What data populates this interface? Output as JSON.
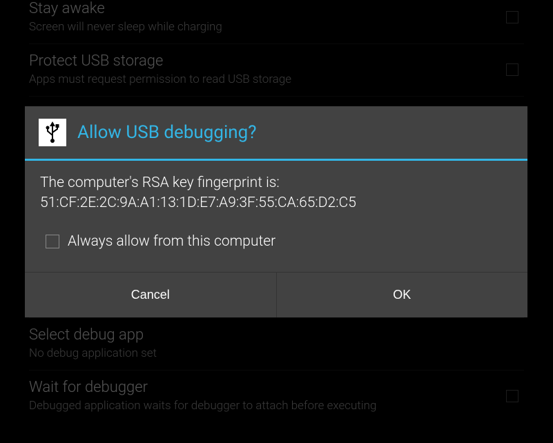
{
  "settings": {
    "items": [
      {
        "title": "Stay awake",
        "subtitle": "Screen will never sleep while charging",
        "hasCheckbox": true
      },
      {
        "title": "Protect USB storage",
        "subtitle": "Apps must request permission to read USB storage",
        "hasCheckbox": true
      },
      {
        "title": "Select debug app",
        "subtitle": "No debug application set",
        "hasCheckbox": false
      },
      {
        "title": "Wait for debugger",
        "subtitle": "Debugged application waits for debugger to attach before executing",
        "hasCheckbox": true
      }
    ]
  },
  "dialog": {
    "title": "Allow USB debugging?",
    "body_line1": "The computer's RSA key fingerprint is:",
    "body_line2": "51:CF:2E:2C:9A:A1:13:1D:E7:A9:3F:55:CA:65:D2:C5",
    "checkbox_label": "Always allow from this computer",
    "cancel_label": "Cancel",
    "ok_label": "OK"
  },
  "colors": {
    "accent": "#33b5e5"
  }
}
